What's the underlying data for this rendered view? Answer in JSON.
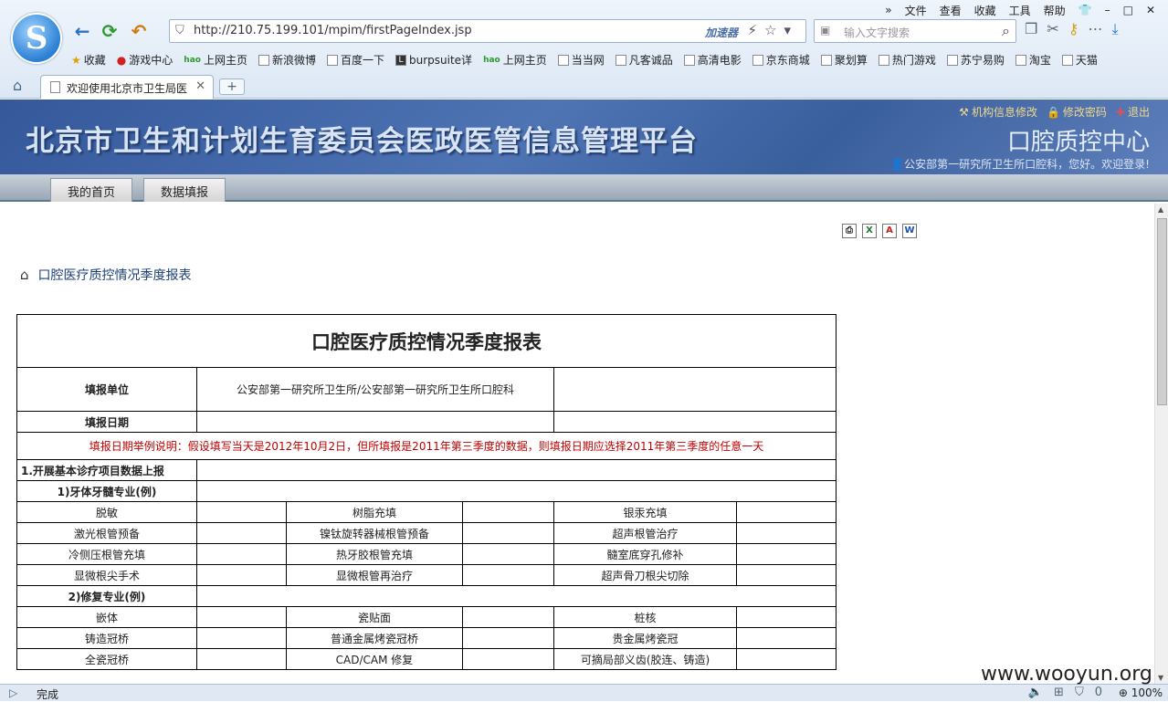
{
  "browser": {
    "logo_letter": "S",
    "menu": [
      "文件",
      "查看",
      "收藏",
      "工具",
      "帮助"
    ],
    "url": "http://210.75.199.101/mpim/firstPageIndex.jsp",
    "accelerator_label": "加速器",
    "search_placeholder": "输入文字搜索",
    "bookmarks": [
      "收藏",
      "游戏中心",
      "上网主页",
      "新浪微博",
      "百度一下",
      "burpsuite详",
      "上网主页",
      "当当网",
      "凡客诚品",
      "高清电影",
      "京东商城",
      "聚划算",
      "热门游戏",
      "苏宁易购",
      "淘宝",
      "天猫"
    ],
    "tab_title": "欢迎使用北京市卫生局医",
    "status_text": "完成",
    "zoom_level": "100%",
    "status_count": "0"
  },
  "header": {
    "title": "北京市卫生和计划生育委员会医政医管信息管理平台",
    "link_org_info": "机构信息修改",
    "link_change_password": "修改密码",
    "link_logout": "退出",
    "center_name": "口腔质控中心",
    "welcome": "公安部第一研究所卫生所口腔科，您好。欢迎登录!"
  },
  "nav": {
    "home": "我的首页",
    "data_entry": "数据填报"
  },
  "breadcrumb": "口腔医疗质控情况季度报表",
  "report": {
    "title": "口腔医疗质控情况季度报表",
    "unit_label": "填报单位",
    "unit_value": "公安部第一研究所卫生所/公安部第一研究所卫生所口腔科",
    "date_label": "填报日期",
    "date_note": "填报日期举例说明：假设填写当天是2012年10月2日，但所填报是2011年第三季度的数据，则填报日期应选择2011年第三季度的任意一天",
    "section1": "1.开展基本诊疗项目数据上报",
    "sub1": "1)牙体牙髓专业(例)",
    "sub1_rows": [
      [
        "脱敏",
        "树脂充填",
        "银汞充填"
      ],
      [
        "激光根管预备",
        "镍钛旋转器械根管预备",
        "超声根管治疗"
      ],
      [
        "冷侧压根管充填",
        "热牙胶根管充填",
        "髓室底穿孔修补"
      ],
      [
        "显微根尖手术",
        "显微根管再治疗",
        "超声骨刀根尖切除"
      ]
    ],
    "sub2": "2)修复专业(例)",
    "sub2_rows": [
      [
        "嵌体",
        "瓷贴面",
        "桩核"
      ],
      [
        "铸造冠桥",
        "普通金属烤瓷冠桥",
        "贵金属烤瓷冠"
      ],
      [
        "全瓷冠桥",
        "CAD/CAM 修复",
        "可摘局部义齿(胶连、铸造)"
      ]
    ]
  },
  "watermark": "www.wooyun.org"
}
